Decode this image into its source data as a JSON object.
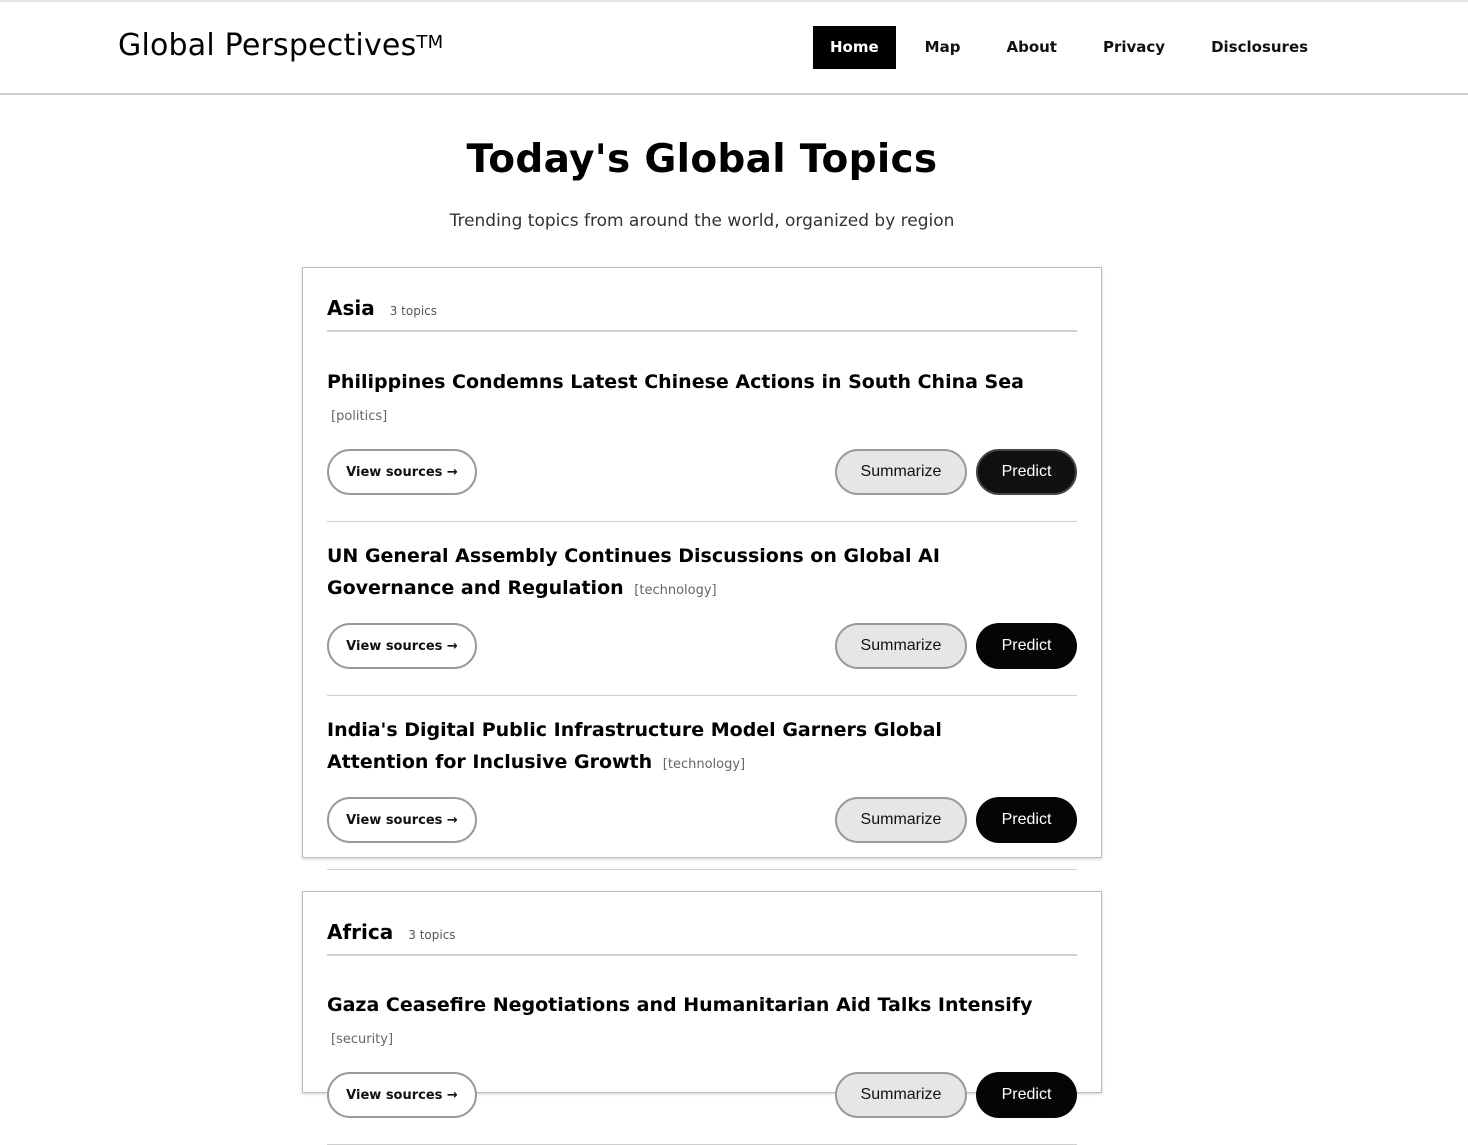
{
  "site": {
    "brand": "Global Perspectives",
    "trademark": "TM"
  },
  "nav": [
    "Home",
    "Map",
    "About",
    "Privacy",
    "Disclosures"
  ],
  "nav_active": "Home",
  "hero": {
    "title": "Today's Global Topics",
    "subtitle": "Trending topics from around the world, organized by region"
  },
  "buttons": {
    "view_sources": "View sources →",
    "summarize": "Summarize",
    "predict": "Predict"
  },
  "regions": [
    {
      "name": "Asia",
      "count": "3 topics",
      "topics": [
        {
          "title": "Philippines Condemns Latest Chinese Actions in South China Sea",
          "tag": "[politics]"
        },
        {
          "title": "UN General Assembly Continues Discussions on Global AI Governance and Regulation",
          "tag": "[technology]"
        },
        {
          "title": "India's Digital Public Infrastructure Model Garners Global Attention for Inclusive Growth",
          "tag": "[technology]"
        }
      ]
    },
    {
      "name": "Africa",
      "count": "3 topics",
      "topics": [
        {
          "title": "Gaza Ceasefire Negotiations and Humanitarian Aid Talks Intensify",
          "tag": "[security]"
        }
      ]
    }
  ]
}
